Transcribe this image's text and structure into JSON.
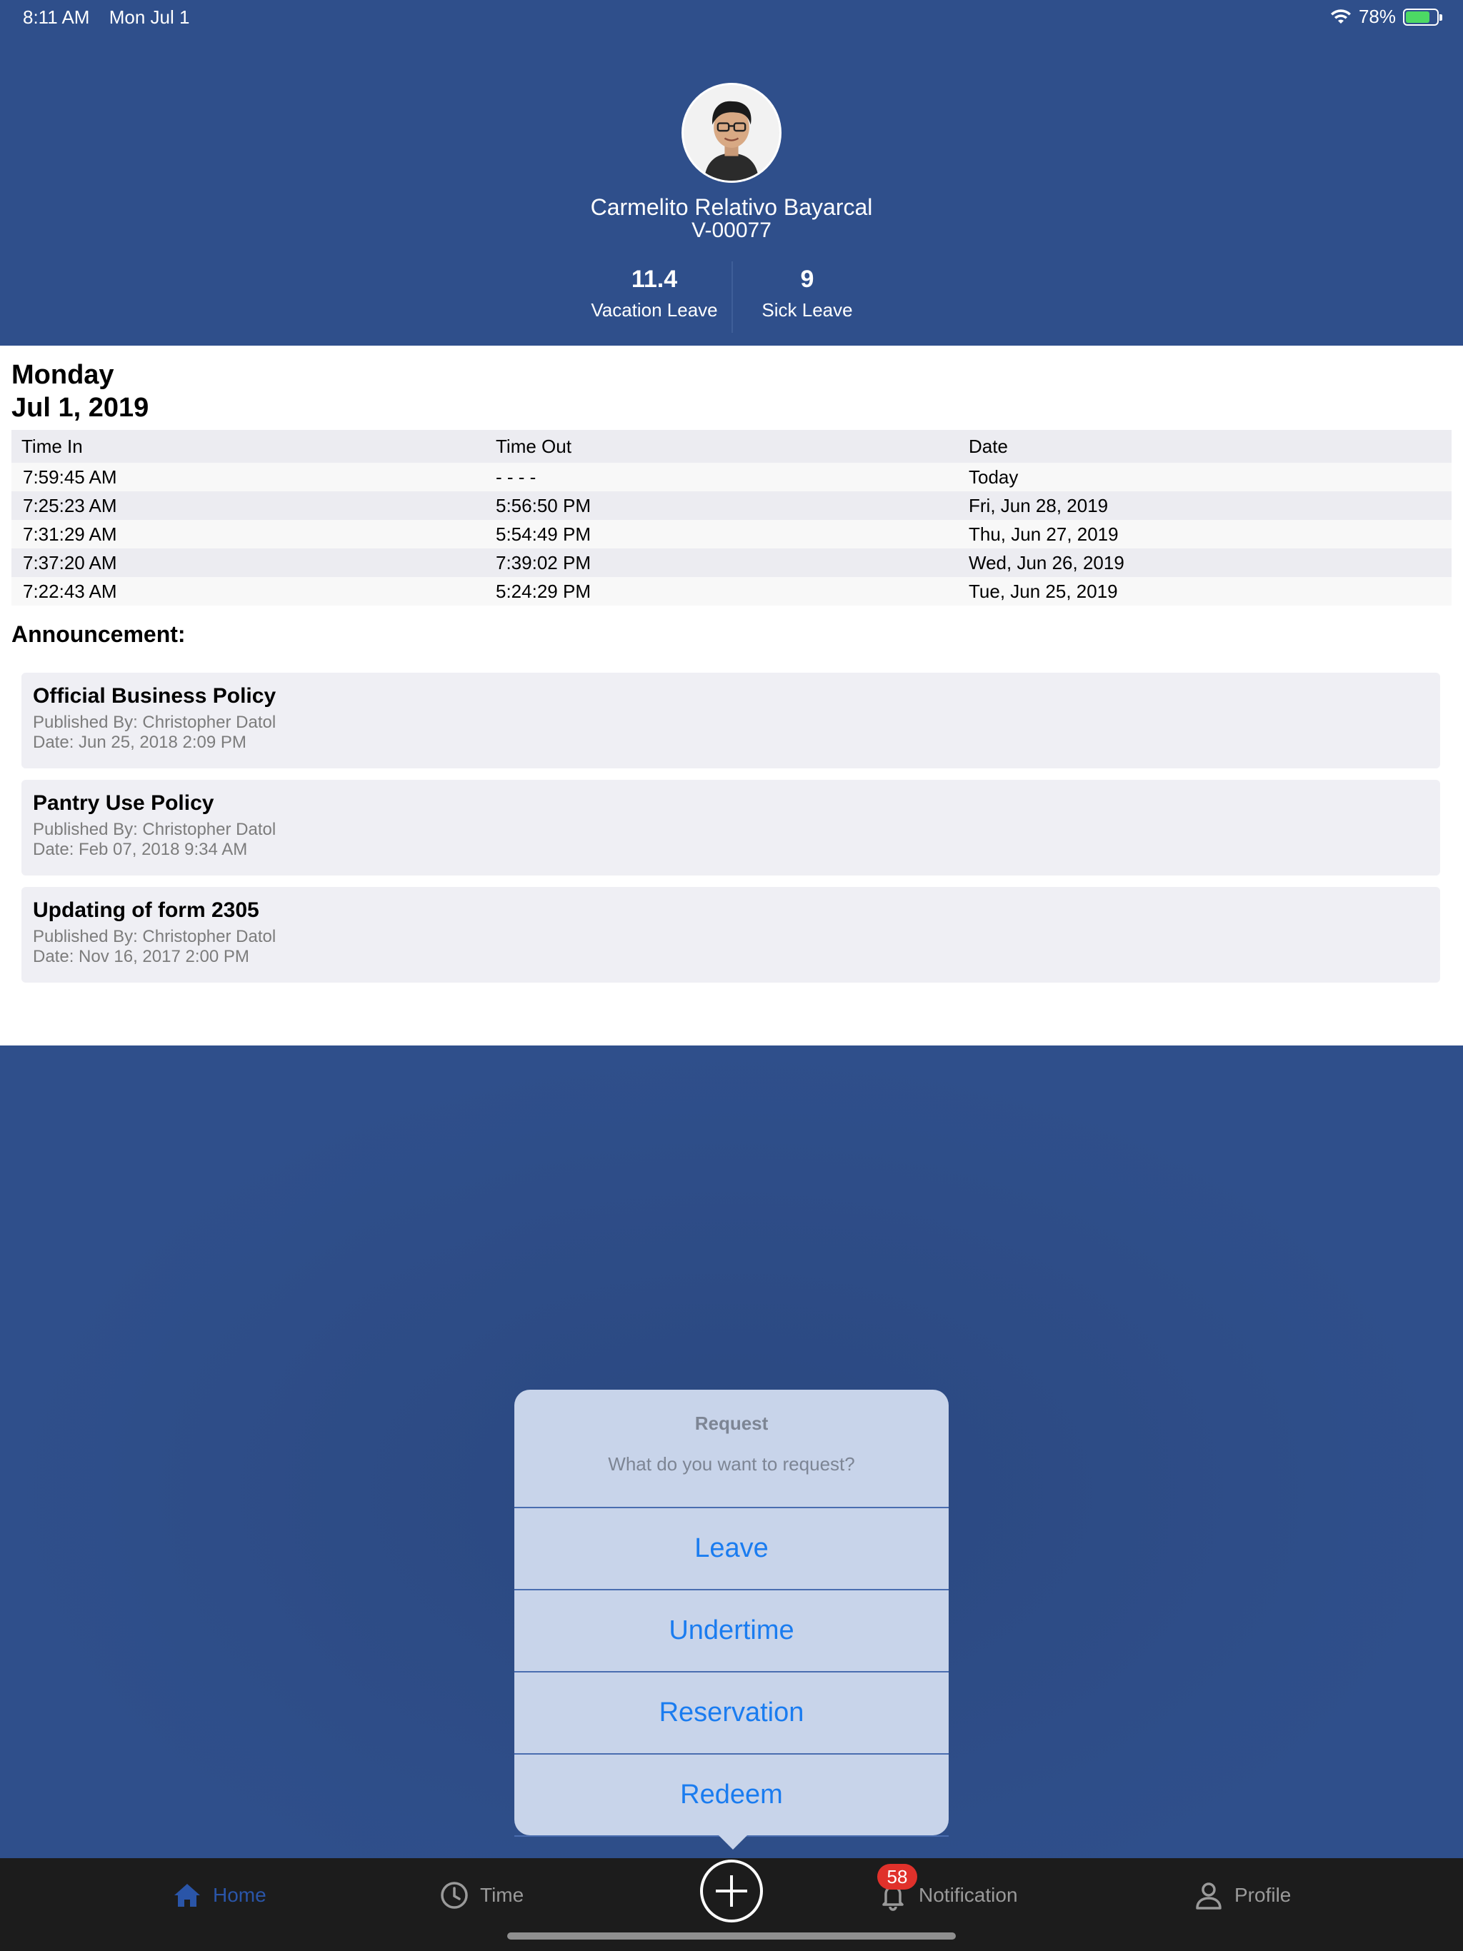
{
  "status_bar": {
    "time": "8:11 AM",
    "date": "Mon Jul 1",
    "battery": "78%"
  },
  "profile": {
    "name": "Carmelito Relativo Bayarcal",
    "employee_id": "V-00077",
    "vacation_leave_value": "11.4",
    "vacation_leave_label": "Vacation Leave",
    "sick_leave_value": "9",
    "sick_leave_label": "Sick Leave"
  },
  "today": {
    "weekday": "Monday",
    "date": "Jul 1, 2019"
  },
  "attendance": {
    "headers": {
      "time_in": "Time In",
      "time_out": "Time Out",
      "date": "Date"
    },
    "rows": [
      {
        "time_in": "7:59:45 AM",
        "time_out": "- - - -",
        "date": "Today"
      },
      {
        "time_in": "7:25:23 AM",
        "time_out": "5:56:50 PM",
        "date": "Fri, Jun 28, 2019"
      },
      {
        "time_in": "7:31:29 AM",
        "time_out": "5:54:49 PM",
        "date": "Thu, Jun 27, 2019"
      },
      {
        "time_in": "7:37:20 AM",
        "time_out": "7:39:02 PM",
        "date": "Wed, Jun 26, 2019"
      },
      {
        "time_in": "7:22:43 AM",
        "time_out": "5:24:29 PM",
        "date": "Tue, Jun 25, 2019"
      }
    ]
  },
  "announcements": {
    "title": "Announcement:",
    "items": [
      {
        "title": "Official Business Policy",
        "published_by": "Published By: Christopher Datol",
        "date": "Date: Jun 25, 2018 2:09 PM"
      },
      {
        "title": "Pantry Use Policy",
        "published_by": "Published By: Christopher Datol",
        "date": "Date: Feb 07, 2018 9:34 AM"
      },
      {
        "title": "Updating of form 2305",
        "published_by": "Published By: Christopher Datol",
        "date": "Date: Nov 16, 2017 2:00 PM"
      }
    ]
  },
  "request_popup": {
    "title": "Request",
    "message": "What do you want to request?",
    "options": [
      "Leave",
      "Undertime",
      "Reservation",
      "Redeem"
    ]
  },
  "tabbar": {
    "home": "Home",
    "time": "Time",
    "notification": "Notification",
    "notification_badge": "58",
    "profile": "Profile",
    "active_color": "#2a55a8"
  },
  "colors": {
    "brand_blue": "#2f4f8b",
    "link_blue": "#1a7cf0",
    "badge_red": "#e0312b"
  }
}
